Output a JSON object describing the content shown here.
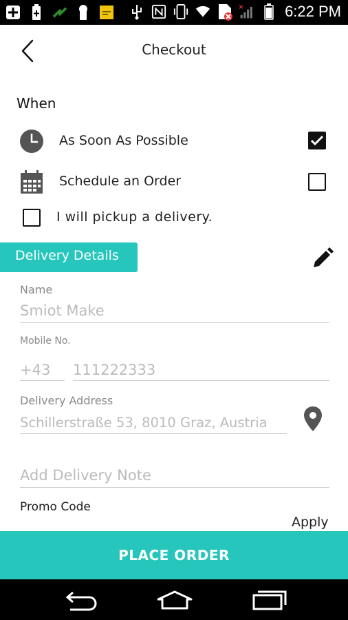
{
  "status_bar": {
    "time": "6:22 PM",
    "icons": [
      "add-icon",
      "battery-saver-icon",
      "satellite-icon",
      "keyhole-icon",
      "sticky-note-icon",
      "usb-icon",
      "nfc-icon",
      "vibrate-icon",
      "wifi-icon",
      "sim-error-icon",
      "signal-icon",
      "battery-icon"
    ]
  },
  "header": {
    "title": "Checkout"
  },
  "when": {
    "label": "When",
    "options": [
      {
        "label": "As Soon As Possible",
        "icon": "clock-icon",
        "checked": true
      },
      {
        "label": "Schedule an Order",
        "icon": "calendar-icon",
        "checked": false
      }
    ],
    "pickup": {
      "label": "I will pickup a delivery.",
      "checked": false
    }
  },
  "delivery_details": {
    "tab_label": "Delivery Details",
    "name": {
      "label": "Name",
      "placeholder": "Smiot Make"
    },
    "mobile": {
      "label": "Mobile No.",
      "country_code": "+43",
      "number": "111222333"
    },
    "address": {
      "label": "Delivery Address",
      "value": "Schillerstraße 53, 8010 Graz, Austria"
    },
    "note": {
      "placeholder": "Add Delivery Note"
    }
  },
  "promo": {
    "label": "Promo Code",
    "apply_label": "Apply"
  },
  "footer": {
    "place_order_label": "PLACE ORDER"
  },
  "colors": {
    "accent": "#26c6bd",
    "status_bar": "#000000",
    "nav_bar": "#000000"
  }
}
